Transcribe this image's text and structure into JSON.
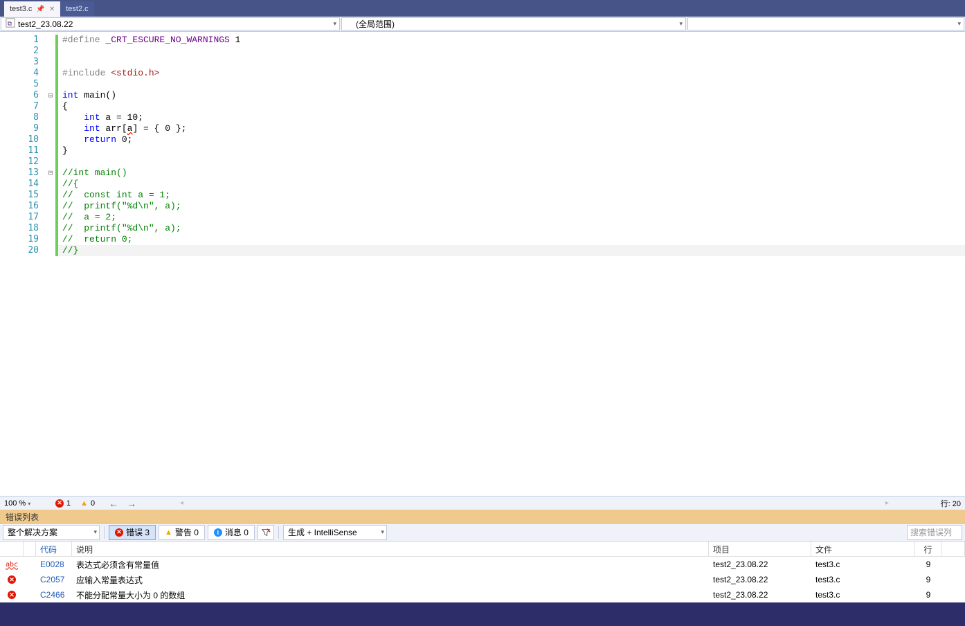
{
  "tabs": [
    {
      "label": "test3.c",
      "active": true,
      "pinned": true
    },
    {
      "label": "test2.c",
      "active": false
    }
  ],
  "context": {
    "scope1_icon": "cpp-file-icon",
    "scope1": "test2_23.08.22",
    "scope2": "(全局范围)",
    "scope3": ""
  },
  "code_lines": [
    {
      "n": 1,
      "fold": "",
      "html": "<span class='pp'>#define</span> <span class='mac'>_CRT_ESCURE_NO_WARNINGS</span> 1"
    },
    {
      "n": 2,
      "fold": "",
      "html": ""
    },
    {
      "n": 3,
      "fold": "",
      "html": ""
    },
    {
      "n": 4,
      "fold": "",
      "html": "<span class='pp'>#include</span> <span class='str'>&lt;stdio.h&gt;</span>"
    },
    {
      "n": 5,
      "fold": "",
      "html": ""
    },
    {
      "n": 6,
      "fold": "⊟",
      "html": "<span class='kw'>int</span> main()"
    },
    {
      "n": 7,
      "fold": "",
      "html": "{"
    },
    {
      "n": 8,
      "fold": "",
      "html": "    <span class='kw'>int</span> a = 10;"
    },
    {
      "n": 9,
      "fold": "",
      "html": "    <span class='kw'>int</span> arr[<span class='wavy'>a</span>] = { 0 };"
    },
    {
      "n": 10,
      "fold": "",
      "html": "    <span class='kw'>return</span> 0;"
    },
    {
      "n": 11,
      "fold": "",
      "html": "}"
    },
    {
      "n": 12,
      "fold": "",
      "html": ""
    },
    {
      "n": 13,
      "fold": "⊟",
      "html": "<span class='com'>//int main()</span>"
    },
    {
      "n": 14,
      "fold": "",
      "html": "<span class='com'>//{</span>"
    },
    {
      "n": 15,
      "fold": "",
      "html": "<span class='com'>//  const int a = 1;</span>"
    },
    {
      "n": 16,
      "fold": "",
      "html": "<span class='com'>//  printf(\"%d\\n\", a);</span>"
    },
    {
      "n": 17,
      "fold": "",
      "html": "<span class='com'>//  a = 2;</span>"
    },
    {
      "n": 18,
      "fold": "",
      "html": "<span class='com'>//  printf(\"%d\\n\", a);</span>"
    },
    {
      "n": 19,
      "fold": "",
      "html": "<span class='com'>//  return 0;</span>"
    },
    {
      "n": 20,
      "fold": "",
      "html": "<span class='com'>//}</span>",
      "current": true
    }
  ],
  "status": {
    "zoom": "100 %",
    "err_count": "1",
    "warn_count": "0",
    "line_info": "行: 20"
  },
  "error_panel": {
    "title": "错误列表",
    "solution_dd": "整个解决方案",
    "btn_errors": "错误 3",
    "btn_warnings": "警告 0",
    "btn_messages": "消息 0",
    "build_dd": "生成 + IntelliSense",
    "search_placeholder": "搜索错误列",
    "headers": {
      "code": "代码",
      "desc": "说明",
      "proj": "项目",
      "file": "文件",
      "line": "行"
    },
    "rows": [
      {
        "sev": "intellisense",
        "code": "E0028",
        "desc": "表达式必须含有常量值",
        "proj": "test2_23.08.22",
        "file": "test3.c",
        "line": "9"
      },
      {
        "sev": "error",
        "code": "C2057",
        "desc": "应输入常量表达式",
        "proj": "test2_23.08.22",
        "file": "test3.c",
        "line": "9"
      },
      {
        "sev": "error",
        "code": "C2466",
        "desc": "不能分配常量大小为 0 的数组",
        "proj": "test2_23.08.22",
        "file": "test3.c",
        "line": "9"
      }
    ]
  }
}
